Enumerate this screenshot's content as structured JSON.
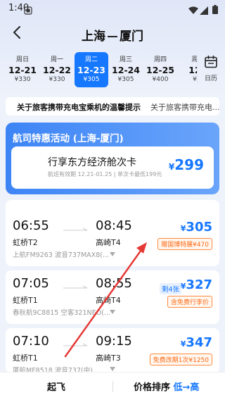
{
  "status_bar": {
    "time": "1:40"
  },
  "header": {
    "from": "上海",
    "to": "厦门"
  },
  "dates": [
    {
      "weekday": "周日",
      "date": "12-21",
      "price": "¥330",
      "selected": false
    },
    {
      "weekday": "周一",
      "date": "12-22",
      "price": "¥330",
      "selected": false
    },
    {
      "weekday": "周二",
      "date": "12-23",
      "price": "¥305",
      "selected": true
    },
    {
      "weekday": "周三",
      "date": "12-24",
      "price": "¥305",
      "selected": false
    },
    {
      "weekday": "周四",
      "date": "12-25",
      "price": "¥400",
      "selected": false
    },
    {
      "weekday": "周",
      "date": "12",
      "price": "¥",
      "selected": false
    }
  ],
  "calendar": {
    "label": "日历"
  },
  "notice": {
    "text1": "关于旅客携带充电宝乘机的温馨提示",
    "text2": "关于旅客携带充电..."
  },
  "promo": {
    "title": "航司特惠活动 (上海-厦门)",
    "card_title": "行享东方经济舱次卡",
    "card_sub": "航班有效期 12.21-01.25 | 单次卡最低199元",
    "price_symbol": "¥",
    "price": "299"
  },
  "flights": [
    {
      "dep_time": "06:55",
      "arr_time": "08:45",
      "dep_airport": "虹桥T2",
      "arr_airport": "高崎T4",
      "info": "上航FM9263 波音737MAX8(...",
      "price_symbol": "¥",
      "price": "305",
      "tag": "赠国博特展¥470",
      "left_tag": ""
    },
    {
      "dep_time": "07:05",
      "arr_time": "08:55",
      "dep_airport": "虹桥T1",
      "arr_airport": "高崎T4",
      "info": "春秋航9C8815 空客321NEO(...",
      "price_symbol": "¥",
      "price": "327",
      "tag": "含免费行李价",
      "left_tag": "剩4张"
    },
    {
      "dep_time": "07:10",
      "arr_time": "09:15",
      "dep_airport": "虹桥T1",
      "arr_airport": "高崎T3",
      "info": "厦航MF8518 波音737(中)",
      "price_symbol": "¥",
      "price": "347",
      "tag": "免费改期1次¥1250",
      "left_tag": ""
    }
  ],
  "bottom_bar": {
    "left": "起飞",
    "right_prefix": "价格排序 ",
    "right_highlight": "低→高"
  },
  "colors": {
    "accent": "#1677ff",
    "tag_orange": "#ff6a14",
    "annotation_red": "#e53935"
  }
}
